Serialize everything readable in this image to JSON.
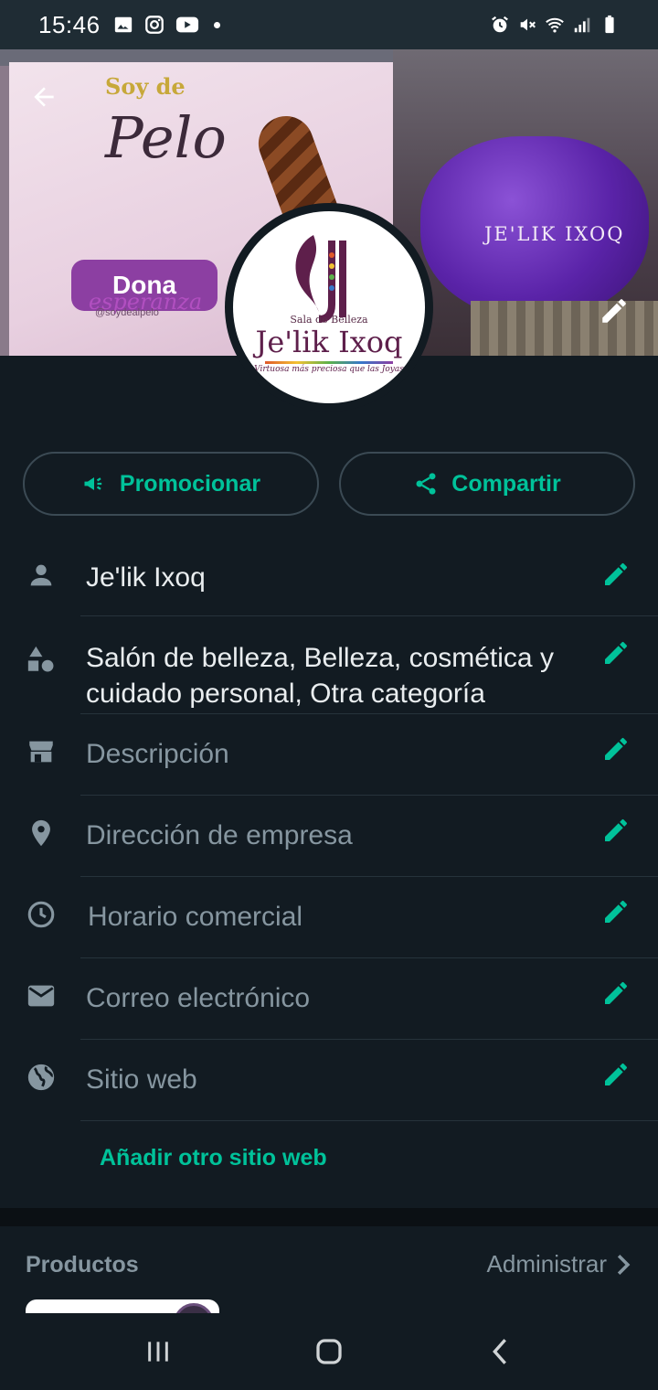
{
  "status_bar": {
    "time": "15:46"
  },
  "cover": {
    "poster_soy": "Soy de",
    "poster_title": "Pelo",
    "poster_dona": "Dona",
    "poster_esperanza": "esperanza",
    "poster_handle": "@soydealpelo",
    "balloon_text": "JE'LIK IXOQ"
  },
  "logo": {
    "sala": "Sala de Belleza",
    "name": "Je'lik Ixoq",
    "tagline": "Virtuosa más preciosa que las Joyas"
  },
  "actions": {
    "promote_label": "Promocionar",
    "share_label": "Compartir"
  },
  "profile": {
    "name": "Je'lik Ixoq",
    "category": "Salón de belleza, Belleza, cosmética y cuidado personal, Otra categoría",
    "description_placeholder": "Descripción",
    "address_placeholder": "Dirección de empresa",
    "hours_placeholder": "Horario comercial",
    "email_placeholder": "Correo electrónico",
    "website_placeholder": "Sitio web",
    "add_website_label": "Añadir otro sitio web"
  },
  "products": {
    "title": "Productos",
    "manage_label": "Administrar"
  },
  "colors": {
    "accent": "#00c29a",
    "background": "#121b22",
    "statusbar": "#1f2c34",
    "muted": "#8696a0"
  },
  "icons": {
    "back": "arrow-left-icon",
    "cover_edit": "pencil-icon",
    "promote": "megaphone-icon",
    "share": "share-icon",
    "name": "person-icon",
    "category": "shapes-icon",
    "description": "storefront-icon",
    "address": "location-pin-icon",
    "hours": "clock-icon",
    "email": "envelope-icon",
    "website": "globe-icon",
    "manage": "chevron-right-icon"
  }
}
